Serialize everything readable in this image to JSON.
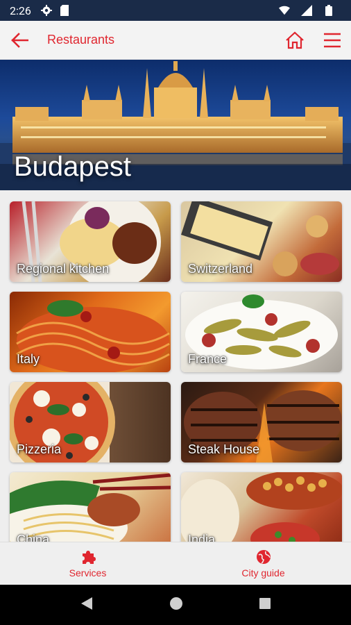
{
  "status_bar": {
    "time": "2:26"
  },
  "app_bar": {
    "title": "Restaurants"
  },
  "hero": {
    "city": "Budapest"
  },
  "categories": [
    {
      "label": "Regional kitchen"
    },
    {
      "label": "Switzerland"
    },
    {
      "label": "Italy"
    },
    {
      "label": "France"
    },
    {
      "label": "Pizzeria"
    },
    {
      "label": "Steak House"
    },
    {
      "label": "China"
    },
    {
      "label": "India"
    }
  ],
  "bottom_nav": {
    "services_label": "Services",
    "city_guide_label": "City guide"
  },
  "colors": {
    "accent": "#e0262f",
    "status_bar": "#1a2b48"
  }
}
